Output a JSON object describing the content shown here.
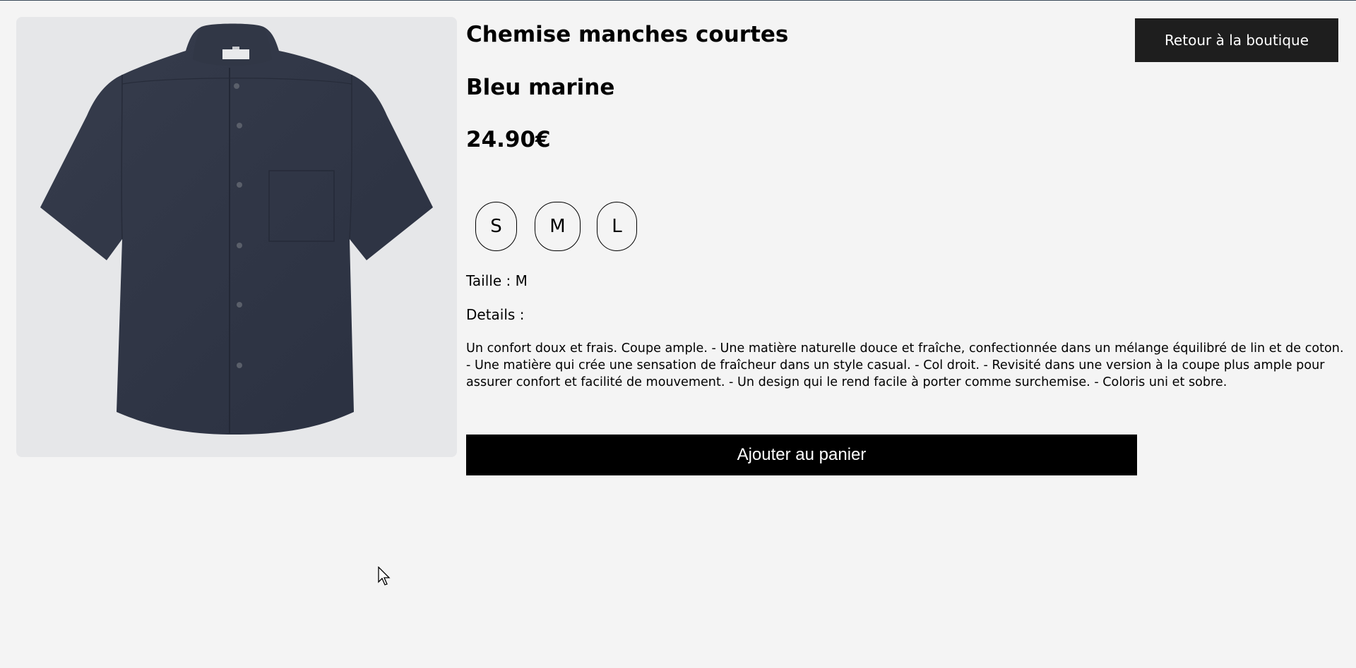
{
  "product": {
    "title": "Chemise manches courtes",
    "color": "Bleu marine",
    "price": "24.90€",
    "image_icon": "navy-short-sleeve-shirt-image"
  },
  "header": {
    "back_label": "Retour à la boutique"
  },
  "sizes": {
    "options": [
      "S",
      "M",
      "L"
    ],
    "selected_text": "Taille : M"
  },
  "details": {
    "label": "Details :",
    "text": "Un confort doux et frais. Coupe ample. - Une matière naturelle douce et fraîche, confectionnée dans un mélange équilibré de lin et de coton. - Une matière qui crée une sensation de fraîcheur dans un style casual. - Col droit. - Revisité dans une version à la coupe plus ample pour assurer confort et facilité de mouvement. - Un design qui le rend facile à porter comme surchemise. - Coloris uni et sobre."
  },
  "cart": {
    "add_label": "Ajouter au panier"
  },
  "colors": {
    "background": "#f4f4f4",
    "button_dark": "#1e1e1e",
    "cart_button": "#000000",
    "shirt": "#2f3544",
    "image_bg": "#e6e7e9"
  }
}
